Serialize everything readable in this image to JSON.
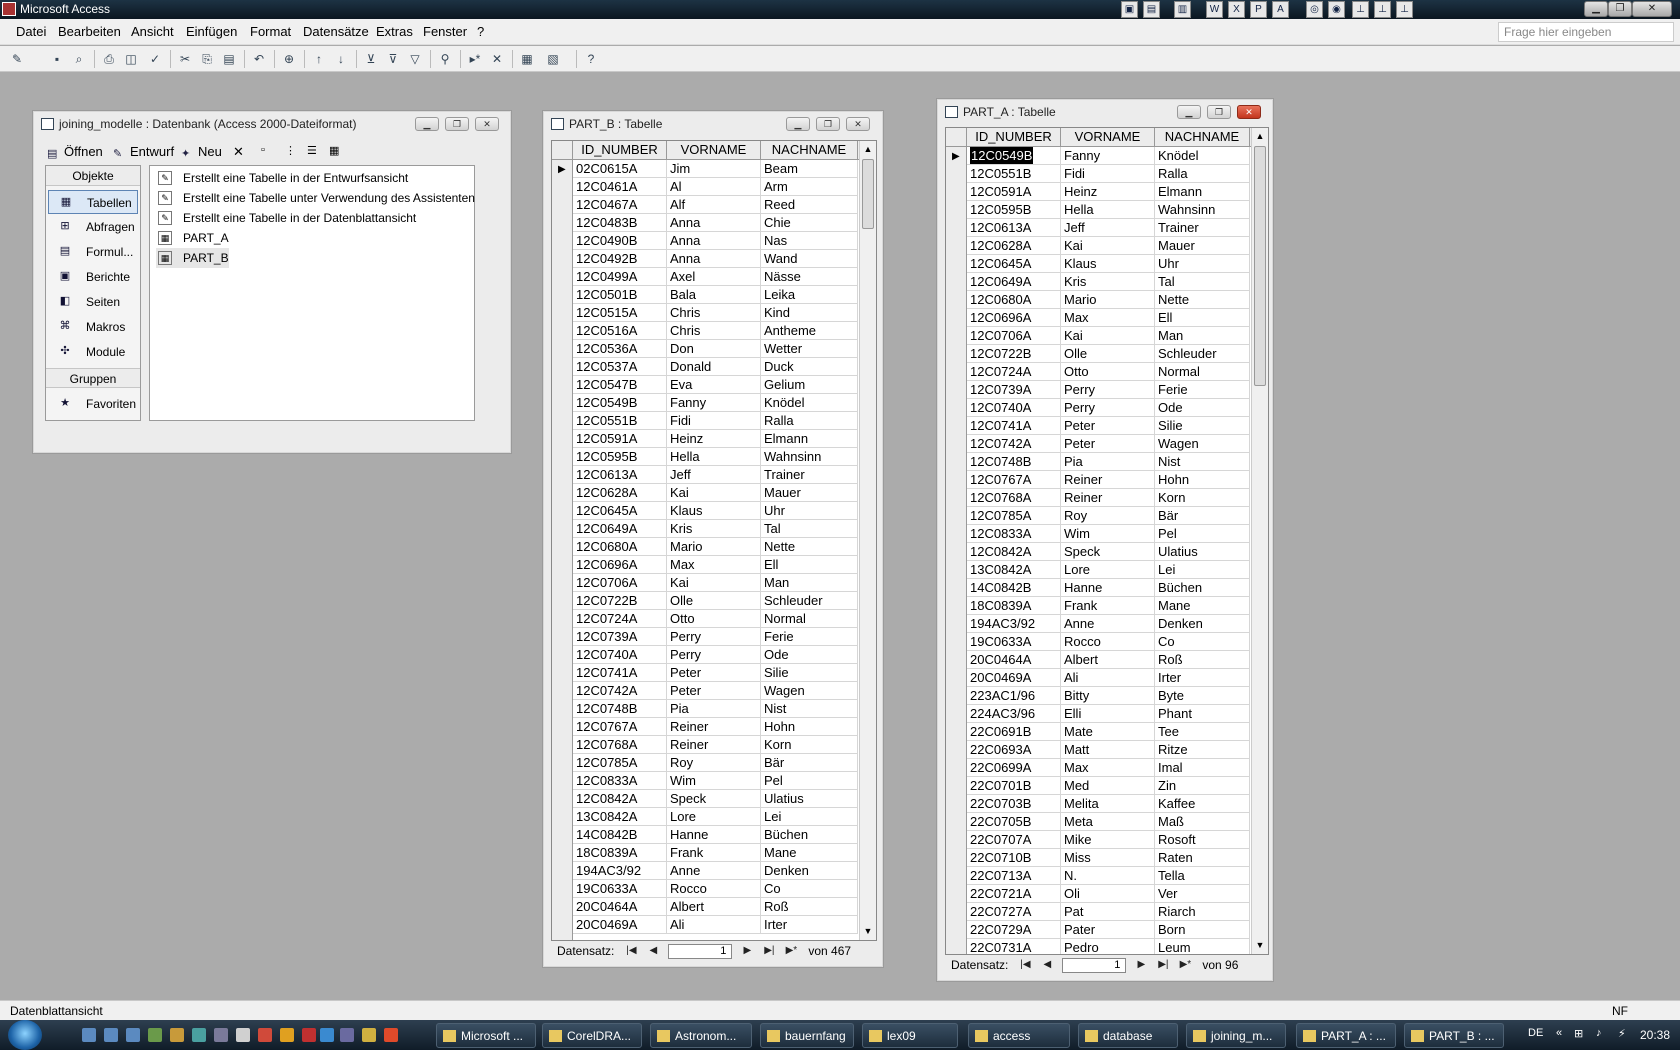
{
  "app": {
    "title": "Microsoft Access",
    "menus": [
      "Datei",
      "Bearbeiten",
      "Ansicht",
      "Einfügen",
      "Format",
      "Datensätze",
      "Extras",
      "Fenster",
      "?"
    ],
    "ask_placeholder": "Frage hier eingeben"
  },
  "db_window": {
    "title": "joining_modelle : Datenbank (Access 2000-Dateiformat)",
    "toolbar": {
      "open": "Öffnen",
      "design": "Entwurf",
      "new": "Neu"
    },
    "objects_header": "Objekte",
    "objects": [
      "Tabellen",
      "Abfragen",
      "Formul...",
      "Berichte",
      "Seiten",
      "Makros",
      "Module"
    ],
    "groups_header": "Gruppen",
    "groups": [
      "Favoriten"
    ],
    "list": [
      "Erstellt eine Tabelle in der Entwurfsansicht",
      "Erstellt eine Tabelle unter Verwendung des Assistenten",
      "Erstellt eine Tabelle in der Datenblattansicht",
      "PART_A",
      "PART_B"
    ]
  },
  "part_b": {
    "title": "PART_B : Tabelle",
    "columns": [
      "ID_NUMBER",
      "VORNAME",
      "NACHNAME"
    ],
    "rows": [
      [
        "02C0615A",
        "Jim",
        "Beam"
      ],
      [
        "12C0461A",
        "Al",
        "Arm"
      ],
      [
        "12C0467A",
        "Alf",
        "Reed"
      ],
      [
        "12C0483B",
        "Anna",
        "Chie"
      ],
      [
        "12C0490B",
        "Anna",
        "Nas"
      ],
      [
        "12C0492B",
        "Anna",
        "Wand"
      ],
      [
        "12C0499A",
        "Axel",
        "Nässe"
      ],
      [
        "12C0501B",
        "Bala",
        "Leika"
      ],
      [
        "12C0515A",
        "Chris",
        "Kind"
      ],
      [
        "12C0516A",
        "Chris",
        "Antheme"
      ],
      [
        "12C0536A",
        "Don",
        "Wetter"
      ],
      [
        "12C0537A",
        "Donald",
        "Duck"
      ],
      [
        "12C0547B",
        "Eva",
        "Gelium"
      ],
      [
        "12C0549B",
        "Fanny",
        "Knödel"
      ],
      [
        "12C0551B",
        "Fidi",
        "Ralla"
      ],
      [
        "12C0591A",
        "Heinz",
        "Elmann"
      ],
      [
        "12C0595B",
        "Hella",
        "Wahnsinn"
      ],
      [
        "12C0613A",
        "Jeff",
        "Trainer"
      ],
      [
        "12C0628A",
        "Kai",
        "Mauer"
      ],
      [
        "12C0645A",
        "Klaus",
        "Uhr"
      ],
      [
        "12C0649A",
        "Kris",
        "Tal"
      ],
      [
        "12C0680A",
        "Mario",
        "Nette"
      ],
      [
        "12C0696A",
        "Max",
        "Ell"
      ],
      [
        "12C0706A",
        "Kai",
        "Man"
      ],
      [
        "12C0722B",
        "Olle",
        "Schleuder"
      ],
      [
        "12C0724A",
        "Otto",
        "Normal"
      ],
      [
        "12C0739A",
        "Perry",
        "Ferie"
      ],
      [
        "12C0740A",
        "Perry",
        "Ode"
      ],
      [
        "12C0741A",
        "Peter",
        "Silie"
      ],
      [
        "12C0742A",
        "Peter",
        "Wagen"
      ],
      [
        "12C0748B",
        "Pia",
        "Nist"
      ],
      [
        "12C0767A",
        "Reiner",
        "Hohn"
      ],
      [
        "12C0768A",
        "Reiner",
        "Korn"
      ],
      [
        "12C0785A",
        "Roy",
        "Bär"
      ],
      [
        "12C0833A",
        "Wim",
        "Pel"
      ],
      [
        "12C0842A",
        "Speck",
        "Ulatius"
      ],
      [
        "13C0842A",
        "Lore",
        "Lei"
      ],
      [
        "14C0842B",
        "Hanne",
        "Büchen"
      ],
      [
        "18C0839A",
        "Frank",
        "Mane"
      ],
      [
        "194AC3/92",
        "Anne",
        "Denken"
      ],
      [
        "19C0633A",
        "Rocco",
        "Co"
      ],
      [
        "20C0464A",
        "Albert",
        "Roß"
      ],
      [
        "20C0469A",
        "Ali",
        "Irter"
      ]
    ],
    "nav": {
      "label": "Datensatz:",
      "current": "1",
      "of": "von 467"
    }
  },
  "part_a": {
    "title": "PART_A : Tabelle",
    "columns": [
      "ID_NUMBER",
      "VORNAME",
      "NACHNAME"
    ],
    "rows": [
      [
        "12C0549B",
        "Fanny",
        "Knödel"
      ],
      [
        "12C0551B",
        "Fidi",
        "Ralla"
      ],
      [
        "12C0591A",
        "Heinz",
        "Elmann"
      ],
      [
        "12C0595B",
        "Hella",
        "Wahnsinn"
      ],
      [
        "12C0613A",
        "Jeff",
        "Trainer"
      ],
      [
        "12C0628A",
        "Kai",
        "Mauer"
      ],
      [
        "12C0645A",
        "Klaus",
        "Uhr"
      ],
      [
        "12C0649A",
        "Kris",
        "Tal"
      ],
      [
        "12C0680A",
        "Mario",
        "Nette"
      ],
      [
        "12C0696A",
        "Max",
        "Ell"
      ],
      [
        "12C0706A",
        "Kai",
        "Man"
      ],
      [
        "12C0722B",
        "Olle",
        "Schleuder"
      ],
      [
        "12C0724A",
        "Otto",
        "Normal"
      ],
      [
        "12C0739A",
        "Perry",
        "Ferie"
      ],
      [
        "12C0740A",
        "Perry",
        "Ode"
      ],
      [
        "12C0741A",
        "Peter",
        "Silie"
      ],
      [
        "12C0742A",
        "Peter",
        "Wagen"
      ],
      [
        "12C0748B",
        "Pia",
        "Nist"
      ],
      [
        "12C0767A",
        "Reiner",
        "Hohn"
      ],
      [
        "12C0768A",
        "Reiner",
        "Korn"
      ],
      [
        "12C0785A",
        "Roy",
        "Bär"
      ],
      [
        "12C0833A",
        "Wim",
        "Pel"
      ],
      [
        "12C0842A",
        "Speck",
        "Ulatius"
      ],
      [
        "13C0842A",
        "Lore",
        "Lei"
      ],
      [
        "14C0842B",
        "Hanne",
        "Büchen"
      ],
      [
        "18C0839A",
        "Frank",
        "Mane"
      ],
      [
        "194AC3/92",
        "Anne",
        "Denken"
      ],
      [
        "19C0633A",
        "Rocco",
        "Co"
      ],
      [
        "20C0464A",
        "Albert",
        "Roß"
      ],
      [
        "20C0469A",
        "Ali",
        "Irter"
      ],
      [
        "223AC1/96",
        "Bitty",
        "Byte"
      ],
      [
        "224AC3/96",
        "Elli",
        "Phant"
      ],
      [
        "22C0691B",
        "Mate",
        "Tee"
      ],
      [
        "22C0693A",
        "Matt",
        "Ritze"
      ],
      [
        "22C0699A",
        "Max",
        "Imal"
      ],
      [
        "22C0701B",
        "Med",
        "Zin"
      ],
      [
        "22C0703B",
        "Melita",
        "Kaffee"
      ],
      [
        "22C0705B",
        "Meta",
        "Maß"
      ],
      [
        "22C0707A",
        "Mike",
        "Rosoft"
      ],
      [
        "22C0710B",
        "Miss",
        "Raten"
      ],
      [
        "22C0713A",
        "N.",
        "Tella"
      ],
      [
        "22C0721A",
        "Oli",
        "Ver"
      ],
      [
        "22C0727A",
        "Pat",
        "Riarch"
      ],
      [
        "22C0729A",
        "Pater",
        "Born"
      ],
      [
        "22C0731A",
        "Pedro",
        "Leum"
      ]
    ],
    "nav": {
      "label": "Datensatz:",
      "current": "1",
      "of": "von 96"
    }
  },
  "status": {
    "left": "Datenblattansicht",
    "right": "NF"
  },
  "taskbar": {
    "tasks": [
      "Microsoft ...",
      "CorelDRA...",
      "Astronom...",
      "bauernfang",
      "lex09",
      "access",
      "database",
      "joining_m...",
      "PART_A : ...",
      "PART_B : ..."
    ],
    "lang": "DE",
    "clock": "20:38"
  }
}
